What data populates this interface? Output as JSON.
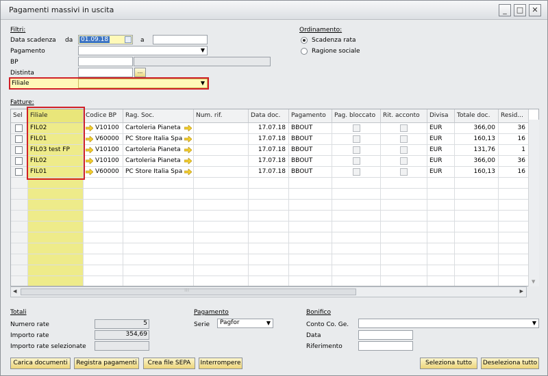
{
  "window": {
    "title": "Pagamenti massivi in uscita",
    "minimize": "_",
    "maximize": "□",
    "close": "✕"
  },
  "filters": {
    "section": "Filtri:",
    "data_scadenza_label": "Data scadenza",
    "da_label": "da",
    "da_value": "01.09.18",
    "a_label": "a",
    "a_value": "",
    "pagamento_label": "Pagamento",
    "pagamento_value": "",
    "bp_label": "BP",
    "bp_value": "",
    "distinta_label": "Distinta",
    "distinta_value": "",
    "ellipsis": "...",
    "filiale_label": "Filiale",
    "filiale_value": ""
  },
  "ordinamento": {
    "title": "Ordinamento:",
    "opt1": "Scadenza rata",
    "opt2": "Ragione sociale",
    "selected": "Scadenza rata"
  },
  "fatture": {
    "section": "Fatture:",
    "columns": [
      "Sel",
      "Filiale",
      "Codice BP",
      "Rag. Soc.",
      "Num. rif.",
      "Data doc.",
      "Pagamento",
      "Pag. bloccato",
      "Rit. acconto",
      "Divisa",
      "Totale doc.",
      "Resid..."
    ],
    "rows": [
      {
        "filiale": "FIL02",
        "codice": "V10100",
        "ragsoc": "Cartoleria Pianeta",
        "data": "17.07.18",
        "pag": "BBOUT",
        "divisa": "EUR",
        "totale": "366,00",
        "resid": "36"
      },
      {
        "filiale": "FIL01",
        "codice": "V60000",
        "ragsoc": "PC Store Italia Spa",
        "data": "17.07.18",
        "pag": "BBOUT",
        "divisa": "EUR",
        "totale": "160,13",
        "resid": "16"
      },
      {
        "filiale": "FIL03 test FP",
        "codice": "V10100",
        "ragsoc": "Cartoleria Pianeta",
        "data": "17.07.18",
        "pag": "BBOUT",
        "divisa": "EUR",
        "totale": "131,76",
        "resid": "1"
      },
      {
        "filiale": "FIL02",
        "codice": "V10100",
        "ragsoc": "Cartoleria Pianeta",
        "data": "17.07.18",
        "pag": "BBOUT",
        "divisa": "EUR",
        "totale": "366,00",
        "resid": "36"
      },
      {
        "filiale": "FIL01",
        "codice": "V60000",
        "ragsoc": "PC Store Italia Spa",
        "data": "17.07.18",
        "pag": "BBOUT",
        "divisa": "EUR",
        "totale": "160,13",
        "resid": "16"
      }
    ],
    "hscroll_grip": ":::"
  },
  "totali": {
    "title": "Totali",
    "numero_label": "Numero rate",
    "numero_value": "5",
    "importo_label": "Importo rate",
    "importo_value": "354,69",
    "importo_sel_label": "Importo rate selezionate",
    "importo_sel_value": ""
  },
  "pagamento": {
    "title": "Pagamento",
    "serie_label": "Serie",
    "serie_value": "Pagfor"
  },
  "bonifico": {
    "title": "Bonifico",
    "conto_label": "Conto Co. Ge.",
    "conto_value": "",
    "data_label": "Data",
    "data_value": "",
    "riferimento_label": "Riferimento",
    "riferimento_value": ""
  },
  "buttons": {
    "carica": "Carica documenti",
    "registra": "Registra pagamenti",
    "crea": "Crea file SEPA",
    "interrompere": "Interrompere",
    "seleziona": "Seleziona tutto",
    "deseleziona": "Deseleziona tutto"
  }
}
